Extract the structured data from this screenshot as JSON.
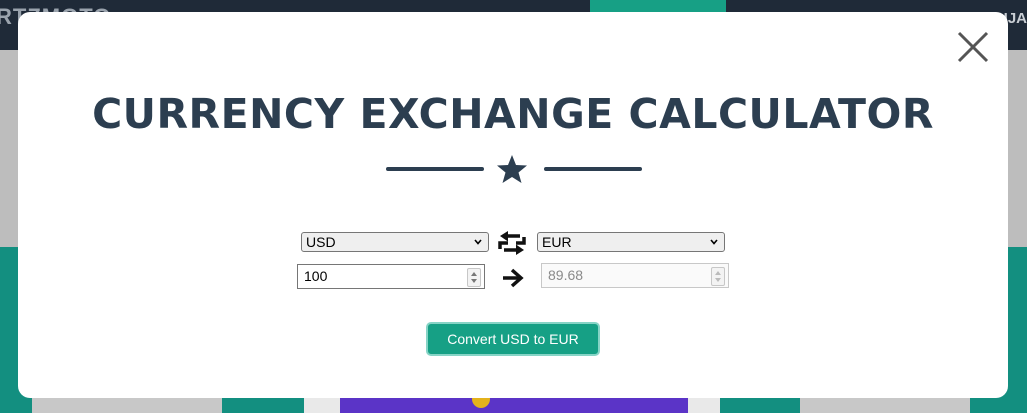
{
  "background": {
    "logo_text": "RTZMOTO",
    "nav_right_text": "IJA"
  },
  "modal": {
    "title": "CURRENCY EXCHANGE CALCULATOR",
    "close_icon": "close-icon",
    "divider_icon": "star-icon"
  },
  "converter": {
    "from_currency": "USD",
    "to_currency": "EUR",
    "from_amount": "100",
    "to_amount": "89.68",
    "swap_icon": "swap-arrows-icon",
    "result_arrow_icon": "right-arrow-icon",
    "button_label": "Convert USD to EUR"
  },
  "colors": {
    "title": "#2c3e50",
    "button": "#16a085",
    "button_border": "#86d4c6",
    "nav": "#1f2a38",
    "nav_active": "#17a085",
    "band": "#138f80"
  }
}
